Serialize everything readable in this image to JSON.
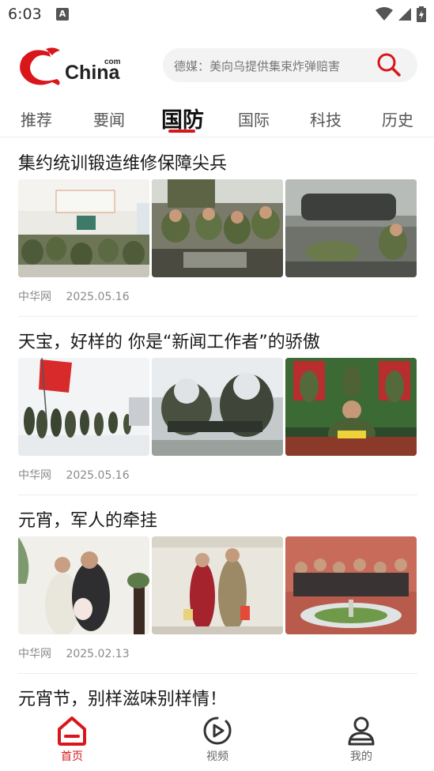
{
  "status_bar": {
    "time": "6:03"
  },
  "header": {
    "logo_text": "China",
    "logo_sup": "com",
    "search_placeholder": "德媒：美向乌提供集束炸弹赔害"
  },
  "tabs": [
    {
      "label": "推荐"
    },
    {
      "label": "要闻"
    },
    {
      "label": "国防",
      "active": true
    },
    {
      "label": "国际"
    },
    {
      "label": "科技"
    },
    {
      "label": "历史"
    }
  ],
  "articles": [
    {
      "title": "集约统训锻造维修保障尖兵",
      "source": "中华网",
      "date": "2025.05.16"
    },
    {
      "title": "天宝，好样的 你是“新闻工作者”的骄傲",
      "source": "中华网",
      "date": "2025.05.16"
    },
    {
      "title": "元宵，军人的牵挂",
      "source": "中华网",
      "date": "2025.02.13"
    },
    {
      "title": "元宵节，别样滋味别样情！"
    }
  ],
  "bottom_nav": [
    {
      "label": "首页",
      "active": true
    },
    {
      "label": "视频"
    },
    {
      "label": "我的"
    }
  ],
  "colors": {
    "accent": "#d9161c"
  }
}
